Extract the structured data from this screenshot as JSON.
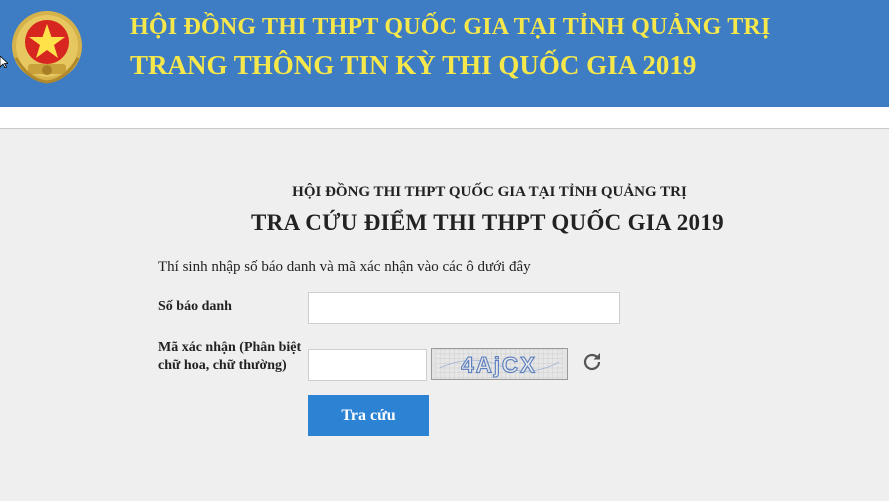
{
  "header": {
    "line1": "HỘI ĐỒNG THI THPT QUỐC GIA TẠI TỈNH QUẢNG TRỊ",
    "line2": "TRANG THÔNG TIN KỲ THI QUỐC GIA 2019",
    "background_color": "#3e7cc4",
    "text_color": "#f6e84a"
  },
  "form": {
    "council": "HỘI ĐỒNG THI THPT QUỐC GIA TẠI TỈNH QUẢNG TRỊ",
    "title": "TRA CỨU ĐIỂM THI THPT QUỐC GIA 2019",
    "instruction": "Thí sinh nhập số báo danh và mã xác nhận vào các ô dưới đây",
    "sbd_label": "Số báo danh",
    "sbd_value": "",
    "captcha_label_line1": "Mã xác nhận (Phân biệt",
    "captcha_label_line2": "chữ hoa, chữ thường)",
    "captcha_value": "",
    "captcha_text": "4AjCX",
    "refresh_icon": "refresh-icon",
    "submit_label": "Tra cứu",
    "submit_color": "#2c82d3"
  }
}
